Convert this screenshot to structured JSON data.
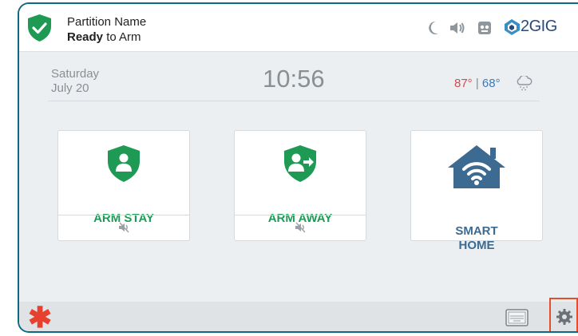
{
  "header": {
    "partition_name": "Partition Name",
    "status_bold": "Ready",
    "status_rest": " to Arm",
    "brand": "2GIG",
    "icons": [
      "moon-icon",
      "speaker-icon",
      "camera-icon",
      "brand-logo-icon"
    ]
  },
  "info": {
    "day": "Saturday",
    "date": "July 20",
    "time": "10:56",
    "temp_high": "87°",
    "temp_sep": " | ",
    "temp_low": "68°",
    "weather_icon": "snow-cloud-icon"
  },
  "tiles": [
    {
      "label": "ARM STAY",
      "icon": "shield-user-icon",
      "sub_icon": "mute-icon"
    },
    {
      "label": "ARM AWAY",
      "icon": "shield-user-exit-icon",
      "sub_icon": "mute-icon"
    },
    {
      "label_line1": "SMART",
      "label_line2": "HOME",
      "icon": "wifi-home-icon"
    }
  ],
  "footer": {
    "emergency_icon": "asterisk-icon",
    "keypad_icon": "keyboard-icon",
    "settings_icon": "gear-icon"
  },
  "colors": {
    "green": "#1e9a55",
    "blue": "#3c6a91",
    "border": "#0e6a80",
    "highlight": "#e0502c"
  }
}
